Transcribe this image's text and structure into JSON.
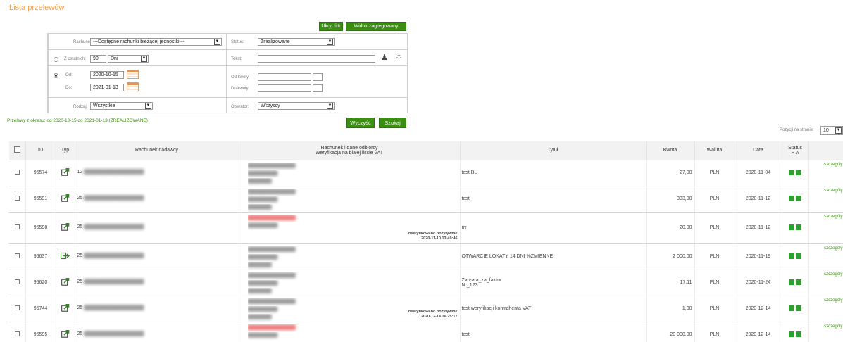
{
  "page": {
    "title": "Lista przelewów"
  },
  "buttons": {
    "hide_filter": "Ukryj filtr",
    "aggregated_view": "Widok zagregowany",
    "clear": "Wyczyść",
    "search": "Szukaj"
  },
  "filter": {
    "account_label": "Rachunek:",
    "account_value": "---Dostępne rachunki bieżącej jednostki---",
    "status_label": "Status:",
    "status_value": "Zrealizowane",
    "last_label": "Z ostatnich:",
    "last_value": "90",
    "last_unit": "Dni",
    "text_label": "Tekst:",
    "from_label": "Od:",
    "from_value": "2020-10-15",
    "to_label": "Do:",
    "to_value": "2021-01-13",
    "amount_from_label": "Od kwoty",
    "amount_to_label": "Do kwoty",
    "type_label": "Rodzaj:",
    "type_value": "Wszystkie",
    "operator_label": "Operator:",
    "operator_value": "Wszyscy"
  },
  "period_text": "Przelewy z okresu: od 2020-10-15 do 2021-01-13 (ZREALIZOWANE)",
  "per_page": {
    "label": "Pozycji na stronie:",
    "value": "10"
  },
  "table": {
    "headers": {
      "id": "ID",
      "type": "Typ",
      "sender": "Rachunek nadawcy",
      "recipient_line1": "Rachunek i dane odbiorcy",
      "recipient_line2": "Weryfikacja na białej liście VAT",
      "title": "Tytuł",
      "amount": "Kwota",
      "currency": "Waluta",
      "date": "Data",
      "status_line1": "Status",
      "status_line2": "P A"
    },
    "details_label": "szczegóły",
    "rows": [
      {
        "id": "95574",
        "type_icon": "outgoing-transfer-icon",
        "sender_prefix": "12",
        "title": "test BL",
        "title2": "",
        "amount": "27,00",
        "currency": "PLN",
        "date": "2020-11-04",
        "verified": "",
        "verified_date": "",
        "recipient_red": false
      },
      {
        "id": "95591",
        "type_icon": "outgoing-transfer-icon",
        "sender_prefix": "25",
        "title": "test",
        "title2": "",
        "amount": "333,00",
        "currency": "PLN",
        "date": "2020-11-12",
        "verified": "",
        "verified_date": "",
        "recipient_red": false
      },
      {
        "id": "95598",
        "type_icon": "outgoing-transfer-icon",
        "sender_prefix": "25",
        "title": "rrr",
        "title2": "",
        "amount": "20,00",
        "currency": "PLN",
        "date": "2020-11-12",
        "verified": "zweryfikowano pozytywnie",
        "verified_date": "2020-11-10 13:49:46",
        "recipient_red": true
      },
      {
        "id": "95637",
        "type_icon": "deposit-transfer-icon",
        "sender_prefix": "25",
        "title": "OTWARCIE LOKATY 14 DNI %ZMIENNE",
        "title2": "",
        "amount": "2 000,00",
        "currency": "PLN",
        "date": "2020-11-19",
        "verified": "",
        "verified_date": "",
        "recipient_red": false
      },
      {
        "id": "95620",
        "type_icon": "outgoing-transfer-icon",
        "sender_prefix": "25",
        "title": "Zap-ata_za_faktur",
        "title2": "Nr_123",
        "amount": "17,11",
        "currency": "PLN",
        "date": "2020-11-24",
        "verified": "",
        "verified_date": "",
        "recipient_red": false
      },
      {
        "id": "95744",
        "type_icon": "outgoing-transfer-icon",
        "sender_prefix": "25",
        "title": "test weryfikacji kontrahenta VAT",
        "title2": "",
        "amount": "1,00",
        "currency": "PLN",
        "date": "2020-12-14",
        "verified": "zweryfikowano pozytywnie",
        "verified_date": "2020-12-14 16:25:17",
        "recipient_red": false
      },
      {
        "id": "95595",
        "type_icon": "outgoing-transfer-icon",
        "sender_prefix": "25",
        "title": "test",
        "title2": "",
        "amount": "20 000,00",
        "currency": "PLN",
        "date": "2020-12-14",
        "verified": "",
        "verified_date": "",
        "recipient_red": true
      }
    ]
  }
}
